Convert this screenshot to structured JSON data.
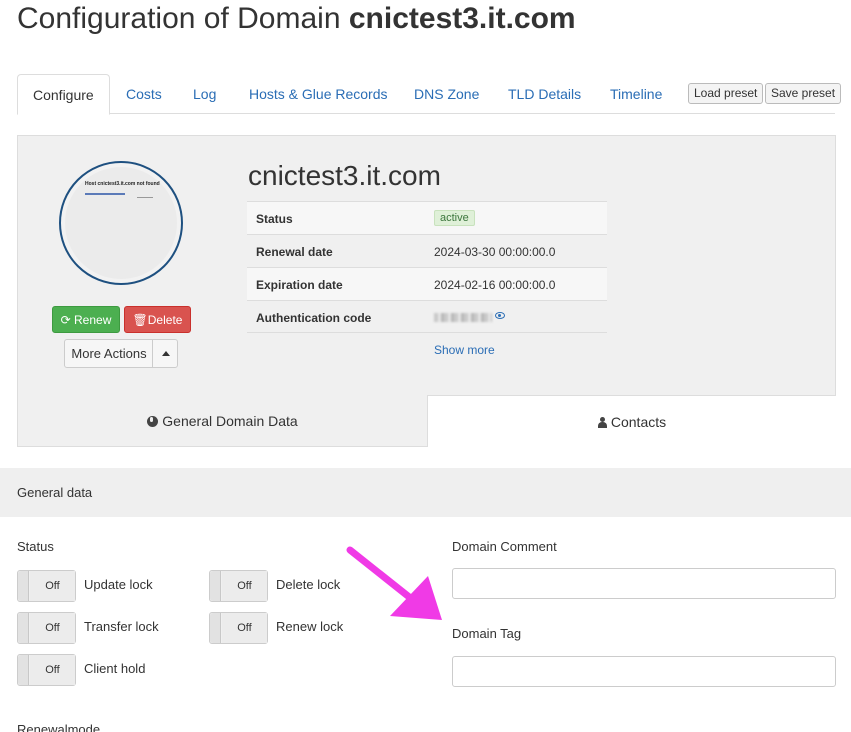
{
  "page": {
    "title_prefix": "Configuration of Domain",
    "title_domain": "cnictest3.it.com"
  },
  "tabs": [
    {
      "label": "Configure"
    },
    {
      "label": "Costs"
    },
    {
      "label": "Log"
    },
    {
      "label": "Hosts & Glue Records"
    },
    {
      "label": "DNS Zone"
    },
    {
      "label": "TLD Details"
    },
    {
      "label": "Timeline"
    }
  ],
  "presets": {
    "load": "Load preset",
    "save": "Save preset"
  },
  "overview": {
    "thumbnail_text": "Host cnictest3.it.com not found",
    "domain": "cnictest3.it.com",
    "rows": [
      {
        "key": "Status",
        "value": "active"
      },
      {
        "key": "Renewal date",
        "value": "2024-03-30 00:00:00.0"
      },
      {
        "key": "Expiration date",
        "value": "2024-02-16 00:00:00.0"
      },
      {
        "key": "Authentication code",
        "value": ""
      }
    ],
    "show_more": "Show more",
    "buttons": {
      "renew": "Renew",
      "delete": "Delete",
      "more": "More Actions"
    },
    "subtabs": {
      "general": "General Domain Data",
      "contacts": "Contacts"
    }
  },
  "general": {
    "section_title": "General data",
    "status_label": "Status",
    "toggles": [
      {
        "label": "Update lock",
        "state": "Off"
      },
      {
        "label": "Delete lock",
        "state": "Off"
      },
      {
        "label": "Transfer lock",
        "state": "Off"
      },
      {
        "label": "Renew lock",
        "state": "Off"
      },
      {
        "label": "Client hold",
        "state": "Off"
      }
    ],
    "domain_comment_label": "Domain Comment",
    "domain_comment_value": "",
    "domain_tag_label": "Domain Tag",
    "domain_tag_value": "",
    "renewalmode_label": "Renewalmode"
  },
  "colors": {
    "link": "#2a6db5",
    "renew": "#4caf50",
    "delete": "#d9534f",
    "annotation_arrow": "#f03ae6",
    "thumb_ring": "#1e5080"
  },
  "icons": {
    "renew": "refresh-icon",
    "delete": "trash-icon",
    "auth": "eye-icon",
    "general": "globe-icon",
    "contacts": "user-icon",
    "more": "caret-up-icon"
  }
}
